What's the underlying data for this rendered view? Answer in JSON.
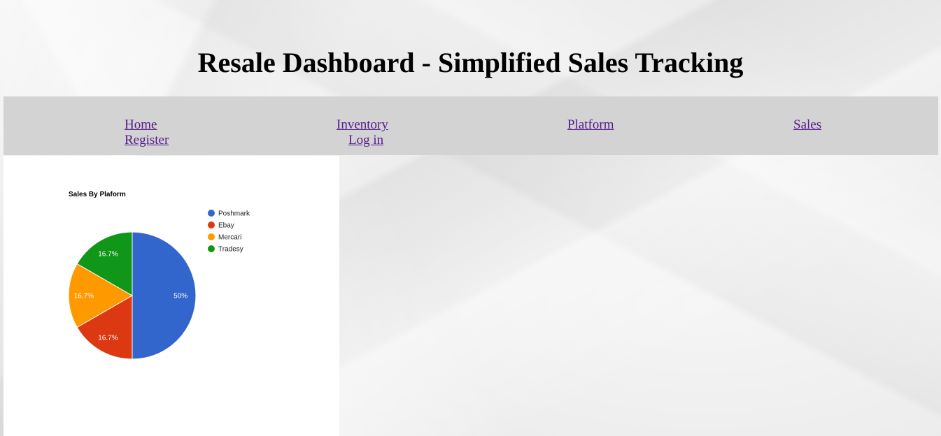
{
  "page": {
    "title": "Resale Dashboard - Simplified Sales Tracking"
  },
  "nav": {
    "home": "Home",
    "inventory": "Inventory",
    "platform": "Platform",
    "sales": "Sales",
    "register": "Register",
    "login": "Log in",
    "link_color": "#551a8b",
    "bar_color": "#d3d3d3"
  },
  "chart_data": {
    "type": "pie",
    "title": "Sales By Plaform",
    "categories": [
      "Poshmark",
      "Ebay",
      "Mercari",
      "Tradesy"
    ],
    "values": [
      3,
      1,
      1,
      1
    ],
    "slice_labels": [
      "50%",
      "16.7%",
      "16.7%",
      "16.7%"
    ],
    "colors": [
      "#3366cc",
      "#dc3912",
      "#ff9900",
      "#109618"
    ],
    "legend_position": "right"
  }
}
